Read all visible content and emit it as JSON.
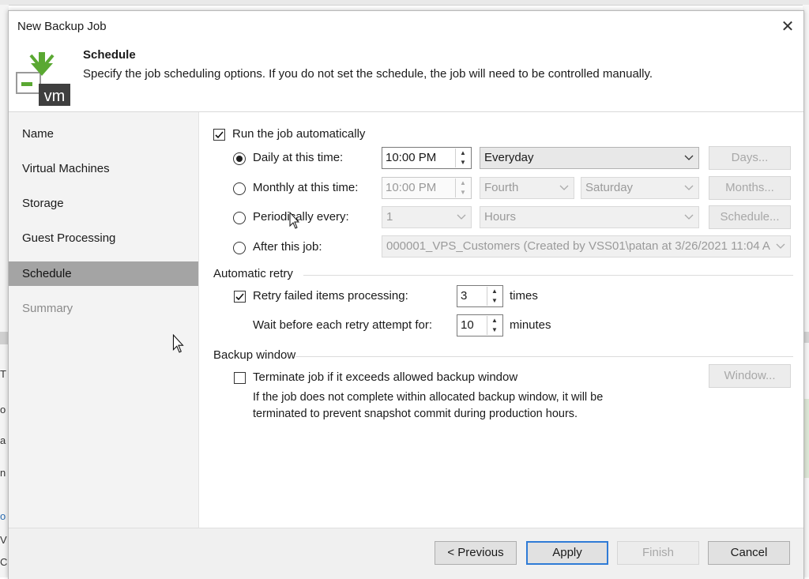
{
  "window": {
    "title": "New Backup Job",
    "close_glyph": "✕"
  },
  "header": {
    "title": "Schedule",
    "description": "Specify the job scheduling options. If you do not set the schedule, the job will need to be controlled manually.",
    "icon": "vm-backup-icon",
    "icon_text": "vm"
  },
  "nav": {
    "items": [
      {
        "label": "Name",
        "state": "normal"
      },
      {
        "label": "Virtual Machines",
        "state": "normal"
      },
      {
        "label": "Storage",
        "state": "normal"
      },
      {
        "label": "Guest Processing",
        "state": "normal"
      },
      {
        "label": "Schedule",
        "state": "active"
      },
      {
        "label": "Summary",
        "state": "disabled"
      }
    ]
  },
  "schedule": {
    "run_automatically": {
      "label": "Run the job automatically",
      "checked": true
    },
    "daily": {
      "label": "Daily at this time:",
      "selected": true,
      "time": "10:00 PM",
      "frequency": "Everyday",
      "button": "Days..."
    },
    "monthly": {
      "label": "Monthly at this time:",
      "selected": false,
      "time": "10:00 PM",
      "week": "Fourth",
      "day": "Saturday",
      "button": "Months..."
    },
    "periodically": {
      "label": "Periodically every:",
      "selected": false,
      "value": "1",
      "unit": "Hours",
      "button": "Schedule..."
    },
    "after_job": {
      "label": "After this job:",
      "selected": false,
      "job": "000001_VPS_Customers (Created by VSS01\\patan at 3/26/2021 11:04 A"
    }
  },
  "automatic_retry": {
    "group_label": "Automatic retry",
    "retry": {
      "label": "Retry failed items processing:",
      "checked": true,
      "value": "3",
      "unit": "times"
    },
    "wait": {
      "label": "Wait before each retry attempt for:",
      "value": "10",
      "unit": "minutes"
    }
  },
  "backup_window": {
    "group_label": "Backup window",
    "terminate": {
      "label": "Terminate job if it exceeds allowed backup window",
      "checked": false
    },
    "note_line1": "If the job does not complete within allocated backup window, it will be",
    "note_line2": "terminated to prevent snapshot commit during production hours.",
    "button": "Window..."
  },
  "footer": {
    "previous": "< Previous",
    "apply": "Apply",
    "finish": "Finish",
    "cancel": "Cancel"
  },
  "background_fragments": [
    "T",
    "o",
    "a",
    "n",
    "o",
    "V",
    "C"
  ],
  "colors": {
    "accent": "#2f7bd6",
    "icon_green": "#5aa832",
    "nav_active": "#a4a4a4"
  }
}
